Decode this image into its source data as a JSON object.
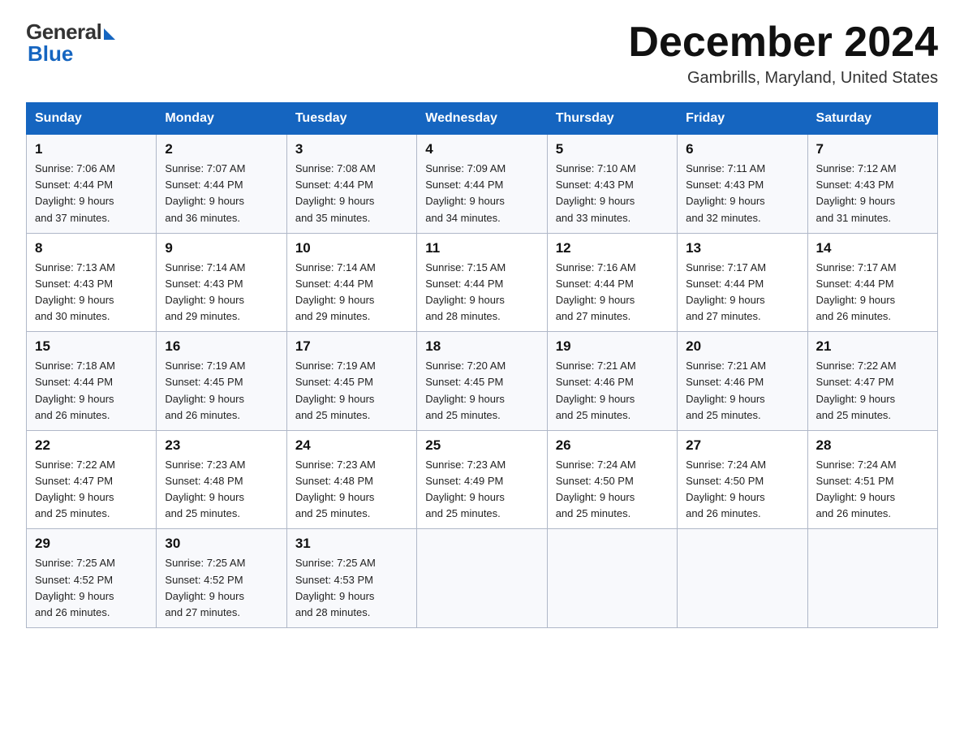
{
  "header": {
    "logo_general": "General",
    "logo_blue": "Blue",
    "month_title": "December 2024",
    "location": "Gambrills, Maryland, United States"
  },
  "days_of_week": [
    "Sunday",
    "Monday",
    "Tuesday",
    "Wednesday",
    "Thursday",
    "Friday",
    "Saturday"
  ],
  "weeks": [
    [
      {
        "day": "1",
        "sunrise": "7:06 AM",
        "sunset": "4:44 PM",
        "daylight": "9 hours and 37 minutes."
      },
      {
        "day": "2",
        "sunrise": "7:07 AM",
        "sunset": "4:44 PM",
        "daylight": "9 hours and 36 minutes."
      },
      {
        "day": "3",
        "sunrise": "7:08 AM",
        "sunset": "4:44 PM",
        "daylight": "9 hours and 35 minutes."
      },
      {
        "day": "4",
        "sunrise": "7:09 AM",
        "sunset": "4:44 PM",
        "daylight": "9 hours and 34 minutes."
      },
      {
        "day": "5",
        "sunrise": "7:10 AM",
        "sunset": "4:43 PM",
        "daylight": "9 hours and 33 minutes."
      },
      {
        "day": "6",
        "sunrise": "7:11 AM",
        "sunset": "4:43 PM",
        "daylight": "9 hours and 32 minutes."
      },
      {
        "day": "7",
        "sunrise": "7:12 AM",
        "sunset": "4:43 PM",
        "daylight": "9 hours and 31 minutes."
      }
    ],
    [
      {
        "day": "8",
        "sunrise": "7:13 AM",
        "sunset": "4:43 PM",
        "daylight": "9 hours and 30 minutes."
      },
      {
        "day": "9",
        "sunrise": "7:14 AM",
        "sunset": "4:43 PM",
        "daylight": "9 hours and 29 minutes."
      },
      {
        "day": "10",
        "sunrise": "7:14 AM",
        "sunset": "4:44 PM",
        "daylight": "9 hours and 29 minutes."
      },
      {
        "day": "11",
        "sunrise": "7:15 AM",
        "sunset": "4:44 PM",
        "daylight": "9 hours and 28 minutes."
      },
      {
        "day": "12",
        "sunrise": "7:16 AM",
        "sunset": "4:44 PM",
        "daylight": "9 hours and 27 minutes."
      },
      {
        "day": "13",
        "sunrise": "7:17 AM",
        "sunset": "4:44 PM",
        "daylight": "9 hours and 27 minutes."
      },
      {
        "day": "14",
        "sunrise": "7:17 AM",
        "sunset": "4:44 PM",
        "daylight": "9 hours and 26 minutes."
      }
    ],
    [
      {
        "day": "15",
        "sunrise": "7:18 AM",
        "sunset": "4:44 PM",
        "daylight": "9 hours and 26 minutes."
      },
      {
        "day": "16",
        "sunrise": "7:19 AM",
        "sunset": "4:45 PM",
        "daylight": "9 hours and 26 minutes."
      },
      {
        "day": "17",
        "sunrise": "7:19 AM",
        "sunset": "4:45 PM",
        "daylight": "9 hours and 25 minutes."
      },
      {
        "day": "18",
        "sunrise": "7:20 AM",
        "sunset": "4:45 PM",
        "daylight": "9 hours and 25 minutes."
      },
      {
        "day": "19",
        "sunrise": "7:21 AM",
        "sunset": "4:46 PM",
        "daylight": "9 hours and 25 minutes."
      },
      {
        "day": "20",
        "sunrise": "7:21 AM",
        "sunset": "4:46 PM",
        "daylight": "9 hours and 25 minutes."
      },
      {
        "day": "21",
        "sunrise": "7:22 AM",
        "sunset": "4:47 PM",
        "daylight": "9 hours and 25 minutes."
      }
    ],
    [
      {
        "day": "22",
        "sunrise": "7:22 AM",
        "sunset": "4:47 PM",
        "daylight": "9 hours and 25 minutes."
      },
      {
        "day": "23",
        "sunrise": "7:23 AM",
        "sunset": "4:48 PM",
        "daylight": "9 hours and 25 minutes."
      },
      {
        "day": "24",
        "sunrise": "7:23 AM",
        "sunset": "4:48 PM",
        "daylight": "9 hours and 25 minutes."
      },
      {
        "day": "25",
        "sunrise": "7:23 AM",
        "sunset": "4:49 PM",
        "daylight": "9 hours and 25 minutes."
      },
      {
        "day": "26",
        "sunrise": "7:24 AM",
        "sunset": "4:50 PM",
        "daylight": "9 hours and 25 minutes."
      },
      {
        "day": "27",
        "sunrise": "7:24 AM",
        "sunset": "4:50 PM",
        "daylight": "9 hours and 26 minutes."
      },
      {
        "day": "28",
        "sunrise": "7:24 AM",
        "sunset": "4:51 PM",
        "daylight": "9 hours and 26 minutes."
      }
    ],
    [
      {
        "day": "29",
        "sunrise": "7:25 AM",
        "sunset": "4:52 PM",
        "daylight": "9 hours and 26 minutes."
      },
      {
        "day": "30",
        "sunrise": "7:25 AM",
        "sunset": "4:52 PM",
        "daylight": "9 hours and 27 minutes."
      },
      {
        "day": "31",
        "sunrise": "7:25 AM",
        "sunset": "4:53 PM",
        "daylight": "9 hours and 28 minutes."
      },
      null,
      null,
      null,
      null
    ]
  ],
  "labels": {
    "sunrise": "Sunrise:",
    "sunset": "Sunset:",
    "daylight": "Daylight:"
  }
}
